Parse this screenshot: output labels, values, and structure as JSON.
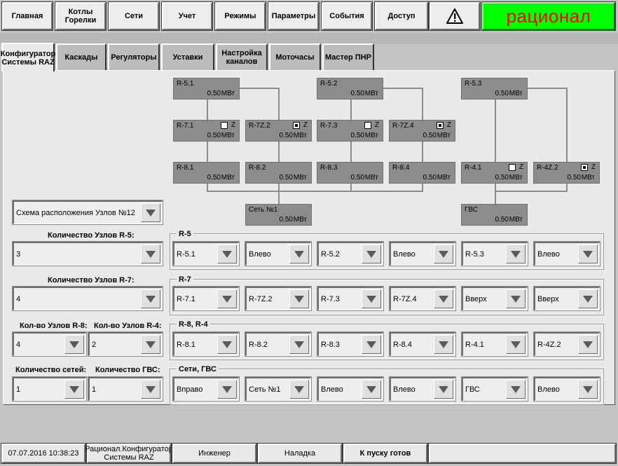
{
  "nav": {
    "buttons": [
      "Главная",
      "Котлы Горелки",
      "Сети",
      "Учет",
      "Режимы",
      "Параметры",
      "События",
      "Доступ"
    ],
    "alert_icon": "warning-icon",
    "brand": "рационал"
  },
  "tabs": [
    "Конфигуратор Системы RAZ",
    "Каскады",
    "Регуляторы",
    "Уставки",
    "Настройка каналов",
    "Моточасы",
    "Мастер ПНР"
  ],
  "diagram": {
    "unit": "МВт",
    "z_label": "Z",
    "nodes": [
      {
        "name": "R-5.1",
        "value": "0.50"
      },
      {
        "name": "R-5.2",
        "value": "0.50"
      },
      {
        "name": "R-5.3",
        "value": "0.50"
      },
      {
        "name": "R-7.1",
        "value": "0.50",
        "z": false
      },
      {
        "name": "R-7Z.2",
        "value": "0.50",
        "z": true
      },
      {
        "name": "R-7.3",
        "value": "0.50",
        "z": false
      },
      {
        "name": "R-7Z.4",
        "value": "0.50",
        "z": true
      },
      {
        "name": "R-8.1",
        "value": "0.50"
      },
      {
        "name": "R-8.2",
        "value": "0.50"
      },
      {
        "name": "R-8.3",
        "value": "0.50"
      },
      {
        "name": "R-8.4",
        "value": "0.50"
      },
      {
        "name": "R-4.1",
        "value": "0.50",
        "z": false
      },
      {
        "name": "R-4Z.2",
        "value": "0.50",
        "z": true
      },
      {
        "name": "Сеть №1",
        "value": "0.50"
      },
      {
        "name": "ГВС",
        "value": "0.50"
      }
    ]
  },
  "scheme": {
    "value": "Схема расположения Узлов №12"
  },
  "left": {
    "r5_label": "Количество Узлов R-5:",
    "r5_value": "3",
    "r7_label": "Количество Узлов R-7:",
    "r7_value": "4",
    "r8_label": "Кол-во Узлов R-8:",
    "r8_value": "4",
    "r4_label": "Кол-во Узлов R-4:",
    "r4_value": "2",
    "nets_label": "Количество сетей:",
    "nets_value": "1",
    "gvs_label": "Количество ГВС:",
    "gvs_value": "1"
  },
  "groups": [
    {
      "title": "R-5",
      "items": [
        "R-5.1",
        "Влево",
        "R-5.2",
        "Влево",
        "R-5.3",
        "Влево"
      ]
    },
    {
      "title": "R-7",
      "items": [
        "R-7.1",
        "R-7Z.2",
        "R-7.3",
        "R-7Z.4",
        "Вверх",
        "Вверх"
      ]
    },
    {
      "title": "R-8, R-4",
      "items": [
        "R-8.1",
        "R-8.2",
        "R-8.3",
        "R-8.4",
        "R-4.1",
        "R-4Z.2"
      ]
    },
    {
      "title": "Сети, ГВС",
      "items": [
        "Вправо",
        "Сеть №1",
        "Влево",
        "Влево",
        "ГВС",
        "Влево"
      ]
    }
  ],
  "status": {
    "datetime": "07.07.2016 10:38:23",
    "screen": "Рационал.Конфигуратор Системы RAZ",
    "user": "Инженер",
    "mode": "Наладка",
    "state": "К пуску готов",
    "empty": ""
  }
}
